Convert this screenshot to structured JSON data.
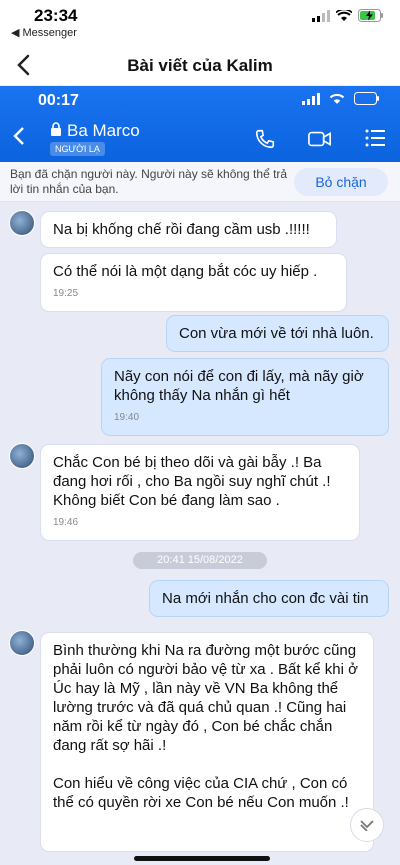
{
  "status_bar": {
    "time": "23:34",
    "back_app": "◀ Messenger"
  },
  "header": {
    "title": "Bài viết của Kalim"
  },
  "zalo": {
    "time": "00:17",
    "contact_name": "Ba Marco",
    "badge": "NGƯỜI LẠ",
    "blocked_notice": "Bạn đã chặn người này. Người này sẽ không thể trả lời tin nhắn của bạn.",
    "unblock_label": "Bỏ chặn",
    "date_separator": "20:41 15/08/2022",
    "messages": [
      {
        "text": "Na bị khống chế rồi đang cầm usb .!!!!!",
        "time": ""
      },
      {
        "text": "Có thể nói là một dạng bắt cóc uy hiếp .",
        "time": "19:25"
      },
      {
        "text": "Con vừa mới về tới nhà luôn.",
        "time": ""
      },
      {
        "text": "Nãy con nói để con đi lấy, mà nãy giờ không thấy Na nhắn gì hết",
        "time": "19:40"
      },
      {
        "text": "Chắc Con bé bị theo dõi và gài bẫy .! Ba đang hơi rối , cho Ba ngồi suy nghĩ chút .! Không biết Con bé đang làm sao .",
        "time": "19:46"
      },
      {
        "text": "Na mới nhắn cho con đc vài tin",
        "time": ""
      },
      {
        "text": "Bình thường khi Na ra đường một bước cũng phải luôn có người bảo vệ từ xa . Bất kể khi ở Úc hay là Mỹ , lần này về VN Ba không thể lường trước và đã quá chủ quan .! Cũng hai năm rồi kể từ ngày đó , Con bé chắc chắn đang rất sợ hãi .!",
        "time": ""
      },
      {
        "text": "Con hiểu về công việc của CIA chứ , Con có thể có quyền rời xe Con bé nếu Con muốn .!",
        "time": ""
      }
    ]
  }
}
